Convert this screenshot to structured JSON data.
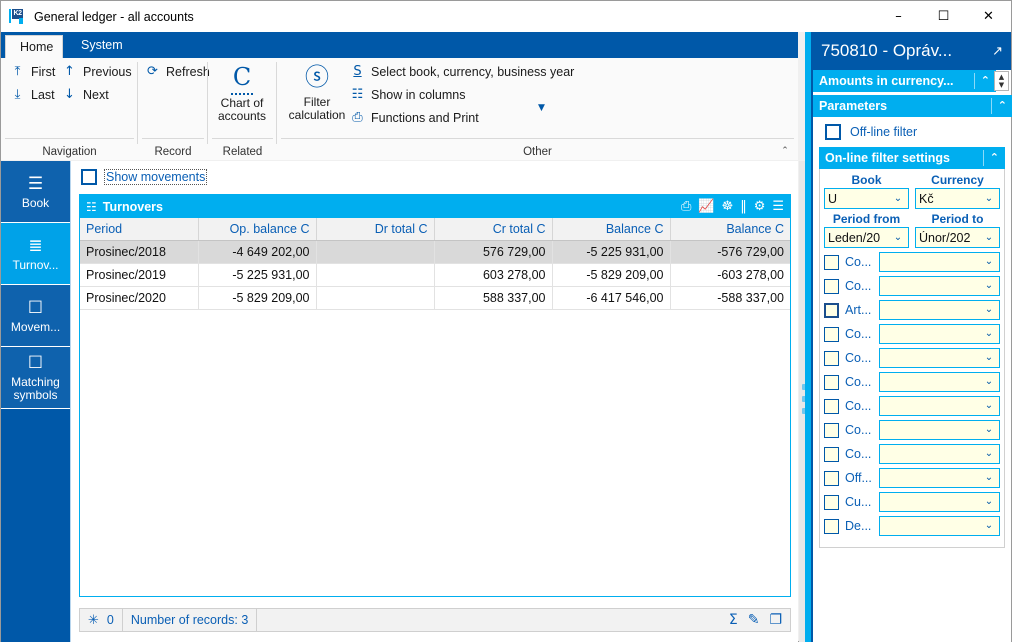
{
  "window": {
    "title": "General ledger - all accounts",
    "logo_text": "K2",
    "controls": {
      "minimize": "–",
      "maximize": "☐",
      "close": "✕"
    }
  },
  "ribbon": {
    "tabs": [
      {
        "label": "Home",
        "active": true
      },
      {
        "label": "System",
        "active": false
      }
    ],
    "collapse_icon": "⌃",
    "groups": [
      {
        "label": "Navigation",
        "items": [
          {
            "label": "First",
            "icon": "⤒"
          },
          {
            "label": "Previous",
            "icon": "↑"
          },
          {
            "label": "Last",
            "icon": "⤓"
          },
          {
            "label": "Next",
            "icon": "↓"
          }
        ]
      },
      {
        "label": "Record",
        "items": [
          {
            "label": "Refresh",
            "icon": "⟳"
          }
        ]
      },
      {
        "label": "Related",
        "big": [
          {
            "label_line1": "Chart of",
            "label_line2": "accounts",
            "icon": "C"
          }
        ]
      },
      {
        "label": "Other",
        "big": [
          {
            "label_line1": "Filter",
            "label_line2": "calculation",
            "icon": "ⓢ"
          }
        ],
        "items": [
          {
            "label": "Select book, currency, business year",
            "icon": "S"
          },
          {
            "label": "Show in columns",
            "icon": "☷"
          },
          {
            "label": "Functions and Print",
            "icon": "⎙"
          }
        ],
        "more_icon": "▼"
      }
    ]
  },
  "sidebar": {
    "items": [
      {
        "label": "Book",
        "icon": "☰",
        "active": false
      },
      {
        "label": "Turnov...",
        "icon": "≣",
        "active": true
      },
      {
        "label": "Movem...",
        "icon": "☐",
        "active": false
      },
      {
        "label": "Matching symbols",
        "icon": "☐",
        "active": false
      }
    ]
  },
  "main": {
    "show_movements_label": "Show movements",
    "show_movements_checked": false,
    "grid": {
      "title": "Turnovers",
      "title_icon": "☷",
      "tools": [
        {
          "name": "print-icon",
          "glyph": "⎙"
        },
        {
          "name": "chart-icon",
          "glyph": "ὌA"
        },
        {
          "name": "group-icon",
          "glyph": "☸"
        },
        {
          "name": "columns-icon",
          "glyph": "‖"
        },
        {
          "name": "settings-icon",
          "glyph": "⚙"
        },
        {
          "name": "menu-icon",
          "glyph": "☰"
        }
      ]
    }
  },
  "table": {
    "columns": [
      {
        "label": "Period",
        "align": "left"
      },
      {
        "label": "Op. balance C",
        "align": "right"
      },
      {
        "label": "Dr total C",
        "align": "right"
      },
      {
        "label": "Cr total C",
        "align": "right"
      },
      {
        "label": "Balance C",
        "align": "right"
      },
      {
        "label": "Balance C",
        "align": "right"
      }
    ],
    "rows": [
      {
        "selected": true,
        "cells": [
          "Prosinec/2018",
          "-4 649 202,00",
          "",
          "576 729,00",
          "-5 225 931,00",
          "-576 729,00"
        ]
      },
      {
        "selected": false,
        "cells": [
          "Prosinec/2019",
          "-5 225 931,00",
          "",
          "603 278,00",
          "-5 829 209,00",
          "-603 278,00"
        ]
      },
      {
        "selected": false,
        "cells": [
          "Prosinec/2020",
          "-5 829 209,00",
          "",
          "588 337,00",
          "-6 417 546,00",
          "-588 337,00"
        ]
      }
    ]
  },
  "statusbar": {
    "lock_icon": "✳",
    "lock_count": "0",
    "records_text": "Number of records: 3",
    "right_icons": [
      {
        "name": "sum-icon",
        "glyph": "Σ"
      },
      {
        "name": "edit-icon",
        "glyph": "✎"
      },
      {
        "name": "copy-icon",
        "glyph": "❐"
      }
    ]
  },
  "right_panel": {
    "title": "750810 - Opráv...",
    "title_icon": "↗",
    "amounts_bar": {
      "label": "Amounts in currency...",
      "chevron": "⌃"
    },
    "parameters_bar": {
      "label": "Parameters",
      "chevron": "⌃"
    },
    "spinner": {
      "up": "▲",
      "down": "▼"
    },
    "offline_filter": {
      "label": "Off-line filter",
      "checked": false
    },
    "online_bar": {
      "label": "On-line filter settings",
      "chevron": "⌃"
    },
    "fields": [
      {
        "label": "Book",
        "value": "U"
      },
      {
        "label": "Currency",
        "value": "Kč"
      },
      {
        "label": "Period from",
        "value": "Leden/20"
      },
      {
        "label": "Period to",
        "value": "Únor/202"
      }
    ],
    "dropdown_icon": "⌄",
    "filter_rows": [
      {
        "name": "Co...",
        "checked": false,
        "strong": false,
        "value": ""
      },
      {
        "name": "Co...",
        "checked": false,
        "strong": false,
        "value": ""
      },
      {
        "name": "Art...",
        "checked": false,
        "strong": true,
        "value": ""
      },
      {
        "name": "Co...",
        "checked": false,
        "strong": false,
        "value": ""
      },
      {
        "name": "Co...",
        "checked": false,
        "strong": false,
        "value": ""
      },
      {
        "name": "Co...",
        "checked": false,
        "strong": false,
        "value": ""
      },
      {
        "name": "Co...",
        "checked": false,
        "strong": false,
        "value": ""
      },
      {
        "name": "Co...",
        "checked": false,
        "strong": false,
        "value": ""
      },
      {
        "name": "Co...",
        "checked": false,
        "strong": false,
        "value": ""
      },
      {
        "name": "Off...",
        "checked": false,
        "strong": false,
        "value": ""
      },
      {
        "name": "Cu...",
        "checked": false,
        "strong": false,
        "value": ""
      },
      {
        "name": "De...",
        "checked": false,
        "strong": false,
        "value": ""
      }
    ]
  },
  "colors": {
    "ribbon_blue": "#0058a8",
    "accent_cyan": "#00aeef",
    "sidebar_blue": "#0f62ad",
    "sidebar_active": "#00a2e8",
    "field_yellow": "#ffffe6",
    "link_blue": "#0a5fb5"
  }
}
